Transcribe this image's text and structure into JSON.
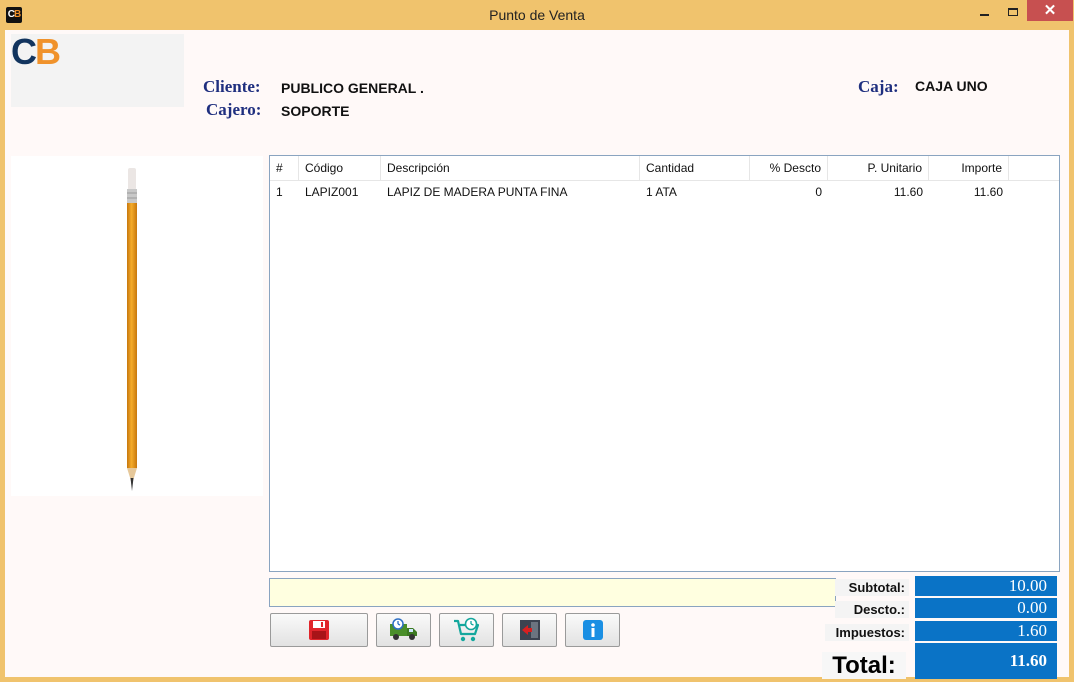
{
  "window": {
    "title": "Punto de Venta",
    "icon": "CB"
  },
  "logo": {
    "c": "C",
    "b": "B"
  },
  "header": {
    "cliente_label": "Cliente:",
    "cliente_value": "PUBLICO GENERAL .",
    "cajero_label": "Cajero:",
    "cajero_value": "SOPORTE",
    "caja_label": "Caja:",
    "caja_value": "CAJA UNO"
  },
  "product_image": {
    "icon": "pencil-icon"
  },
  "table": {
    "columns": [
      "#",
      "Código",
      "Descripción",
      "Cantidad",
      "% Descto",
      "P. Unitario",
      "Importe"
    ],
    "rows": [
      {
        "num": "1",
        "codigo": "LAPIZ001",
        "descripcion": "LAPIZ DE MADERA PUNTA FINA",
        "cantidad": "1 ATA",
        "descto": "0",
        "p_unitario": "11.60",
        "importe": "11.60"
      }
    ]
  },
  "barcode_input": {
    "value": "",
    "placeholder": ""
  },
  "toolbar": [
    {
      "icon": "save-icon",
      "color": "#e0252b"
    },
    {
      "icon": "delivery-truck-icon",
      "color": "#4a8f2a"
    },
    {
      "icon": "cart-clock-icon",
      "color": "#14a79d"
    },
    {
      "icon": "exit-door-icon",
      "color": "#d62020"
    },
    {
      "icon": "info-icon",
      "color": "#1a8fe3"
    }
  ],
  "totals": {
    "subtotal_label": "Subtotal:",
    "subtotal_value": "10.00",
    "descto_label": "Descto.:",
    "descto_value": "0.00",
    "impuestos_label": "Impuestos:",
    "impuestos_value": "1.60",
    "total_label": "Total:",
    "total_value": "11.60"
  },
  "colors": {
    "frame": "#f0c36d",
    "accent_blue": "#0a73c6",
    "label_navy": "#1f2f7f",
    "input_yellow": "#ffffe0"
  }
}
